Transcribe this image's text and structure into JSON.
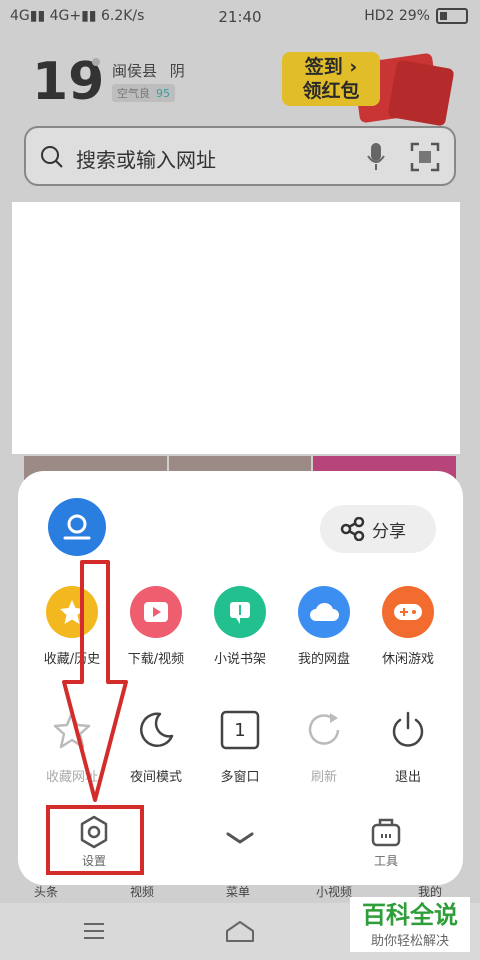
{
  "status_bar": {
    "left": "4G▮▮ 4G+▮▮ 6.2K/s",
    "time": "21:40",
    "right": "HD2 29%"
  },
  "weather": {
    "temperature": "19",
    "location": "闽侯县",
    "condition": "阴",
    "air_label": "空气良",
    "air_value": "95"
  },
  "promo": {
    "line1": "签到 ›",
    "line2": "领红包"
  },
  "search": {
    "placeholder": "搜索或输入网址"
  },
  "menu": {
    "share_label": "分享",
    "row1": [
      {
        "label": "收藏/历史",
        "icon": "star-icon",
        "color": "#f3b81f"
      },
      {
        "label": "下载/视频",
        "icon": "play-icon",
        "color": "#ef5e6e"
      },
      {
        "label": "小说书架",
        "icon": "book-icon",
        "color": "#22c08e"
      },
      {
        "label": "我的网盘",
        "icon": "cloud-icon",
        "color": "#3c8ff0"
      },
      {
        "label": "休闲游戏",
        "icon": "gamepad-icon",
        "color": "#f26b2f"
      }
    ],
    "row2": [
      {
        "label": "收藏网址",
        "icon": "star-outline-icon"
      },
      {
        "label": "夜间模式",
        "icon": "moon-icon"
      },
      {
        "label": "多窗口",
        "icon": "window-count-icon",
        "count": "1"
      },
      {
        "label": "刷新",
        "icon": "refresh-icon"
      },
      {
        "label": "退出",
        "icon": "power-icon"
      }
    ],
    "bottom": {
      "settings_label": "设置",
      "tools_label": "工具"
    }
  },
  "background_tabs": [
    "头条",
    "视频",
    "菜单",
    "小视频",
    "我的"
  ],
  "watermark": {
    "line1": "百科全说",
    "line2": "助你轻松解决"
  },
  "colors": {
    "annotation_red": "#d42b2b",
    "avatar_blue": "#2a7ee0"
  }
}
